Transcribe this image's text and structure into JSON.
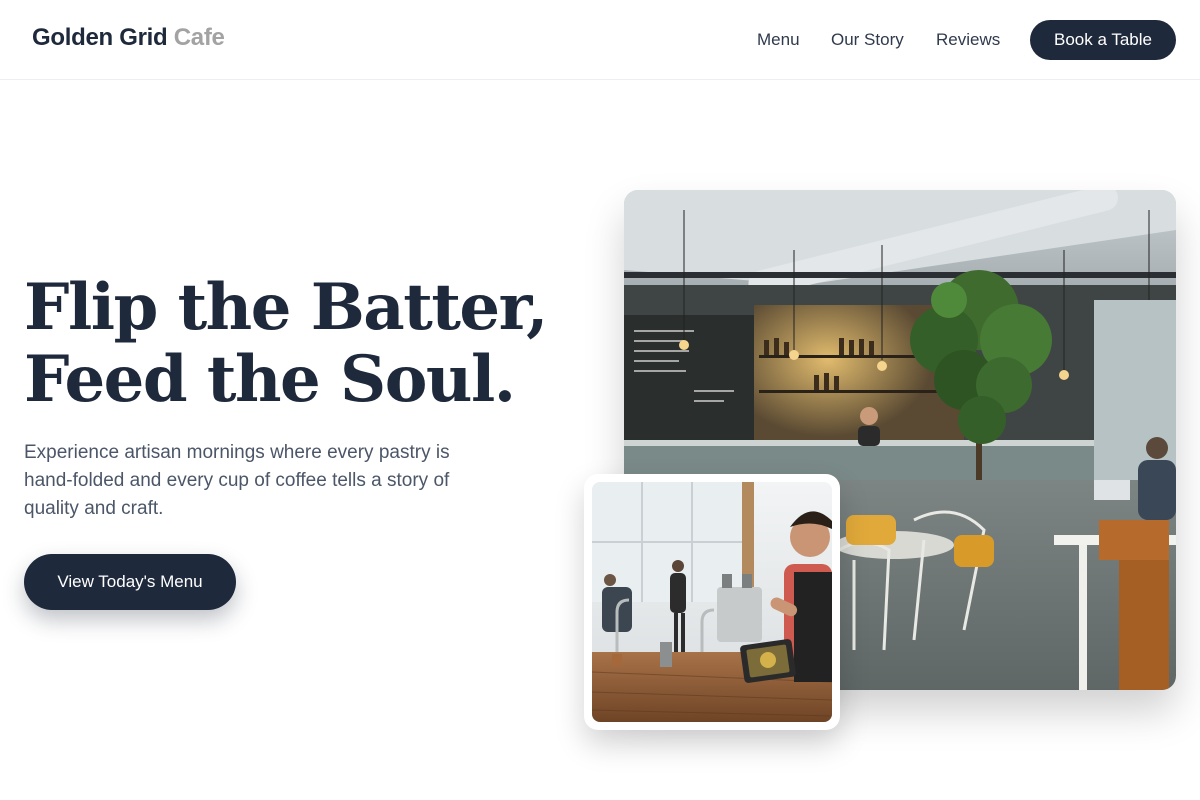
{
  "header": {
    "brand_primary": "Golden Grid",
    "brand_accent": "Cafe",
    "nav": {
      "menu": "Menu",
      "story": "Our Story",
      "reviews": "Reviews"
    },
    "book_button": "Book a Table"
  },
  "hero": {
    "title_line1": "Flip the Batter,",
    "title_line2": "Feed the Soul.",
    "description": "Experience artisan mornings where every pastry is hand-folded and every cup of coffee tells a story of quality and craft.",
    "cta": "View Today's Menu"
  },
  "images": {
    "main_photo": "cafe-interior-photo",
    "secondary_photo": "barista-counter-photo"
  },
  "colors": {
    "brand_dark": "#1e293b",
    "brand_accent_gray": "#a3a3a3",
    "body_text": "#4b5668",
    "background": "#ffffff"
  }
}
